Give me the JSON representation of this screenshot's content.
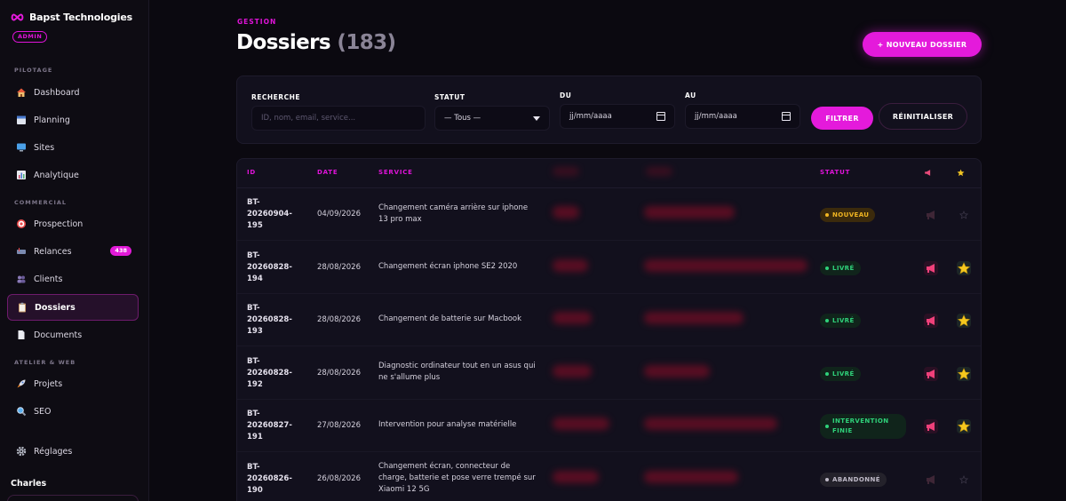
{
  "brand": {
    "name": "Bapst Technologies",
    "badge": "ADMIN"
  },
  "sidebar": {
    "sections": [
      {
        "label": "PILOTAGE"
      },
      {
        "label": "COMMERCIAL"
      },
      {
        "label": "ATELIER & WEB"
      }
    ],
    "items": [
      {
        "label": "Dashboard",
        "icon": "house-icon"
      },
      {
        "label": "Planning",
        "icon": "calendar-icon"
      },
      {
        "label": "Sites",
        "icon": "monitor-icon"
      },
      {
        "label": "Analytique",
        "icon": "bar-chart-icon"
      },
      {
        "label": "Prospection",
        "icon": "target-icon"
      },
      {
        "label": "Relances",
        "icon": "mailbox-icon",
        "badge": "438"
      },
      {
        "label": "Clients",
        "icon": "users-icon"
      },
      {
        "label": "Dossiers",
        "icon": "clipboard-icon",
        "active": true
      },
      {
        "label": "Documents",
        "icon": "document-icon"
      },
      {
        "label": "Projets",
        "icon": "rocket-icon"
      },
      {
        "label": "SEO",
        "icon": "magnifier-icon"
      },
      {
        "label": "Réglages",
        "icon": "gear-icon"
      }
    ],
    "user": "Charles"
  },
  "header": {
    "eyebrow": "GESTION",
    "title": "Dossiers",
    "count": "(183)",
    "new_button": "+ NOUVEAU DOSSIER"
  },
  "filters": {
    "search_label": "RECHERCHE",
    "search_placeholder": "ID, nom, email, service...",
    "status_label": "STATUT",
    "status_value": "— Tous —",
    "from_label": "DU",
    "from_value": "jj/mm/aaaa",
    "to_label": "AU",
    "to_value": "jj/mm/aaaa",
    "filter_button": "FILTRER",
    "reset_button": "RÉINITIALISER"
  },
  "table": {
    "columns": {
      "id": "ID",
      "date": "DATE",
      "service": "SERVICE",
      "status": "STATUT"
    },
    "rows": [
      {
        "id_a": "BT-",
        "id_b": "20260904-",
        "id_c": "195",
        "date": "04/09/2026",
        "service": "Changement caméra arrière sur iphone 13 pro max",
        "status": "NOUVEAU",
        "status_kind": "nouveau",
        "flags": false
      },
      {
        "id_a": "BT-",
        "id_b": "20260828-",
        "id_c": "194",
        "date": "28/08/2026",
        "service": "Changement écran iphone SE2 2020",
        "status": "LIVRÉ",
        "status_kind": "livre",
        "flags": true
      },
      {
        "id_a": "BT-",
        "id_b": "20260828-",
        "id_c": "193",
        "date": "28/08/2026",
        "service": "Changement de batterie sur Macbook",
        "status": "LIVRÉ",
        "status_kind": "livre",
        "flags": true
      },
      {
        "id_a": "BT-",
        "id_b": "20260828-",
        "id_c": "192",
        "date": "28/08/2026",
        "service": "Diagnostic ordinateur tout en un asus qui ne s'allume plus",
        "status": "LIVRÉ",
        "status_kind": "livre",
        "flags": true
      },
      {
        "id_a": "BT-",
        "id_b": "20260827-",
        "id_c": "191",
        "date": "27/08/2026",
        "service": "Intervention pour analyse matérielle",
        "status": "INTERVENTION FINIE",
        "status_kind": "fini",
        "flags": true
      },
      {
        "id_a": "BT-",
        "id_b": "20260826-",
        "id_c": "190",
        "date": "26/08/2026",
        "service": "Changement écran, connecteur de charge, batterie et pose verre trempé sur Xiaomi 12 5G",
        "status": "ABANDONNÉ",
        "status_kind": "abandon",
        "flags": false
      }
    ]
  },
  "colors": {
    "accent": "#e41adb",
    "bg": "#0b0910",
    "panel": "#12101d",
    "success": "#2fd17a",
    "warning": "#f2b622"
  }
}
